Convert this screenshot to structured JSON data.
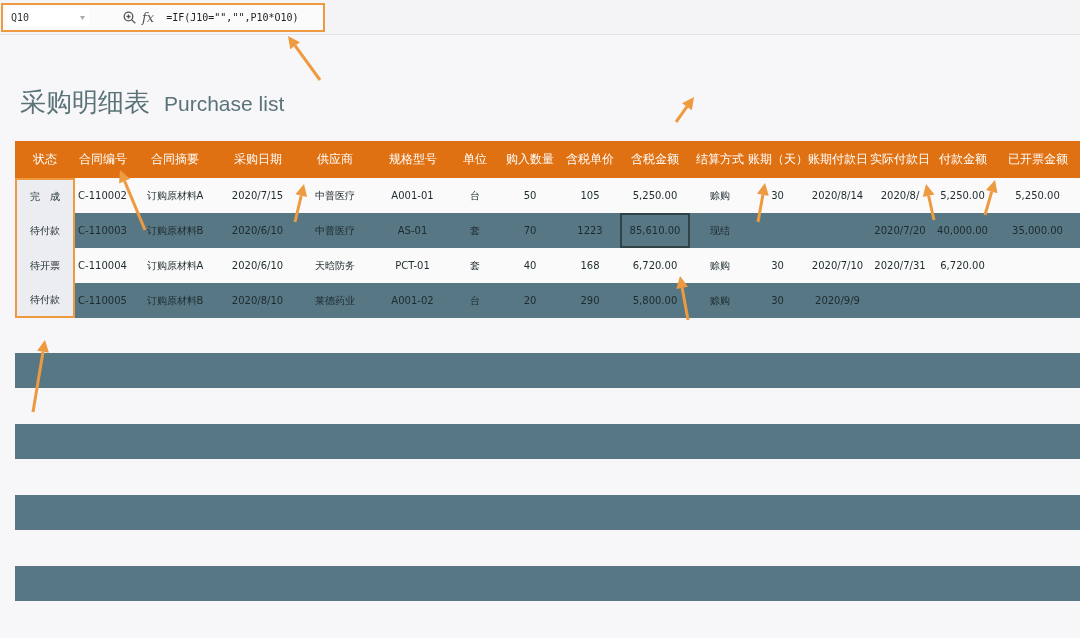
{
  "formula_bar": {
    "name_box": "Q10",
    "fx": "fx",
    "formula": "=IF(J10=\"\",\"\",P10*O10)"
  },
  "title": {
    "chinese": "采购明细表",
    "english": "Purchase list"
  },
  "table": {
    "columns": [
      "状态",
      "合同编号",
      "合同摘要",
      "采购日期",
      "供应商",
      "规格型号",
      "单位",
      "购入数量",
      "含税单价",
      "含税金额",
      "结算方式",
      "账期（天）",
      "账期付款日",
      "实际付款日",
      "付款金额",
      "已开票金额"
    ],
    "rows": [
      {
        "cells": [
          {
            "text": "完　成",
            "selected": false
          },
          {
            "text": "C-110002",
            "selected": false
          },
          {
            "text": "订购原材料A",
            "selected": false
          },
          {
            "text": "2020/7/15",
            "selected": false
          },
          {
            "text": "中普医疗",
            "selected": false
          },
          {
            "text": "A001-01",
            "selected": false
          },
          {
            "text": "台",
            "selected": false
          },
          {
            "text": "50",
            "selected": false
          },
          {
            "text": "105",
            "selected": false
          },
          {
            "text": "5,250.00",
            "selected": false
          },
          {
            "text": "赊购",
            "selected": false
          },
          {
            "text": "30",
            "selected": false
          },
          {
            "text": "2020/8/14",
            "selected": false
          },
          {
            "text": "2020/8/",
            "selected": false
          },
          {
            "text": "5,250.00",
            "selected": false
          },
          {
            "text": "5,250.00",
            "selected": false
          }
        ]
      },
      {
        "cells": [
          {
            "text": "待付款",
            "selected": false
          },
          {
            "text": "C-110003",
            "selected": false
          },
          {
            "text": "订购原材料B",
            "selected": false
          },
          {
            "text": "2020/6/10",
            "selected": false
          },
          {
            "text": "中普医疗",
            "selected": false
          },
          {
            "text": "AS-01",
            "selected": false
          },
          {
            "text": "套",
            "selected": false
          },
          {
            "text": "70",
            "selected": false
          },
          {
            "text": "1223",
            "selected": false
          },
          {
            "text": "85,610.00",
            "selected": true
          },
          {
            "text": "现结",
            "selected": false
          },
          {
            "selected": false
          },
          {
            "selected": false
          },
          {
            "text": "2020/7/20",
            "selected": false
          },
          {
            "text": "40,000.00",
            "selected": false
          },
          {
            "text": "35,000.00",
            "selected": false
          }
        ]
      },
      {
        "cells": [
          {
            "text": "待开票",
            "selected": false
          },
          {
            "text": "C-110004",
            "selected": false
          },
          {
            "text": "订购原材料A",
            "selected": false
          },
          {
            "text": "2020/6/10",
            "selected": false
          },
          {
            "text": "天晗防务",
            "selected": false
          },
          {
            "text": "PCT-01",
            "selected": false
          },
          {
            "text": "套",
            "selected": false
          },
          {
            "text": "40",
            "selected": false
          },
          {
            "text": "168",
            "selected": false
          },
          {
            "text": "6,720.00",
            "selected": false
          },
          {
            "text": "赊购",
            "selected": false
          },
          {
            "text": "30",
            "selected": false
          },
          {
            "text": "2020/7/10",
            "selected": false
          },
          {
            "text": "2020/7/31",
            "selected": false
          },
          {
            "text": "6,720.00",
            "selected": false
          },
          {
            "selected": false
          }
        ]
      },
      {
        "cells": [
          {
            "text": "待付款",
            "selected": false
          },
          {
            "text": "C-110005",
            "selected": false
          },
          {
            "text": "订购原材料B",
            "selected": false
          },
          {
            "text": "2020/8/10",
            "selected": false
          },
          {
            "text": "莱德药业",
            "selected": false
          },
          {
            "text": "A001-02",
            "selected": false
          },
          {
            "text": "台",
            "selected": false
          },
          {
            "text": "20",
            "selected": false
          },
          {
            "text": "290",
            "selected": false
          },
          {
            "text": "5,800.00",
            "selected": false
          },
          {
            "text": "赊购",
            "selected": false
          },
          {
            "text": "30",
            "selected": false
          },
          {
            "text": "2020/9/9",
            "selected": false
          },
          {
            "selected": false
          },
          {
            "selected": false
          },
          {
            "selected": false
          }
        ]
      }
    ]
  }
}
